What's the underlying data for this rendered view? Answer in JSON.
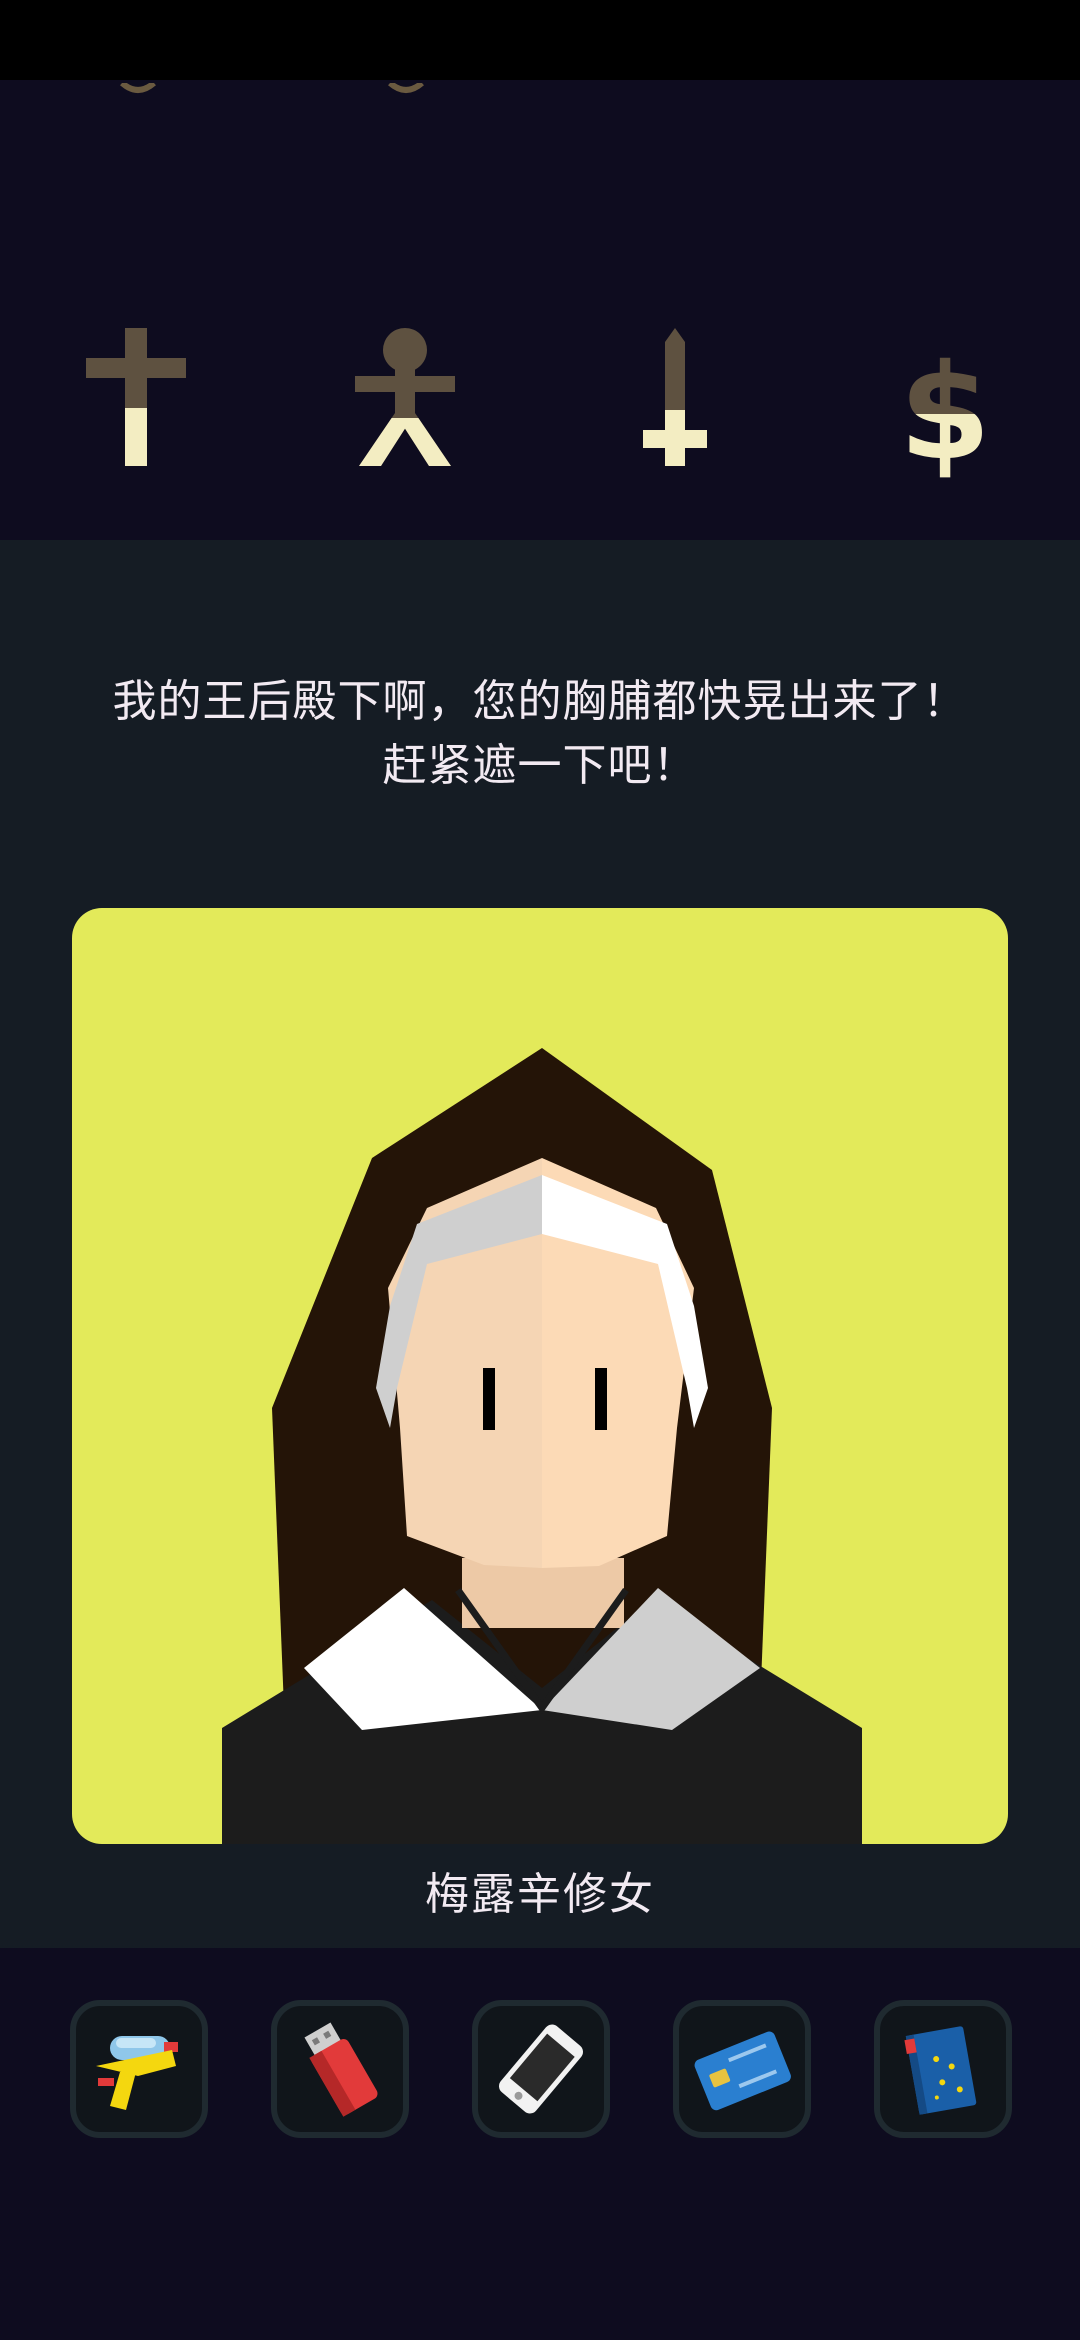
{
  "game": {
    "stats": [
      {
        "icon": "cross-icon",
        "name": "church"
      },
      {
        "icon": "person-icon",
        "name": "people"
      },
      {
        "icon": "sword-icon",
        "name": "army"
      },
      {
        "icon": "dollar-icon",
        "name": "treasury"
      }
    ],
    "dialog": {
      "line1": "我的王后殿下啊，您的胸脯都快晃出来了！",
      "line2": "赶紧遮一下吧！"
    },
    "character": {
      "name": "梅露辛修女",
      "background_color": "#e3ea5a"
    },
    "items": [
      {
        "icon": "water-gun-icon"
      },
      {
        "icon": "usb-drive-icon"
      },
      {
        "icon": "smartphone-icon"
      },
      {
        "icon": "credit-card-icon"
      },
      {
        "icon": "passport-book-icon"
      }
    ],
    "colors": {
      "stat_filled": "#f3edc2",
      "stat_empty": "#5e5140",
      "panel_dark": "#0e0c1f",
      "panel_card": "#151c24"
    }
  }
}
